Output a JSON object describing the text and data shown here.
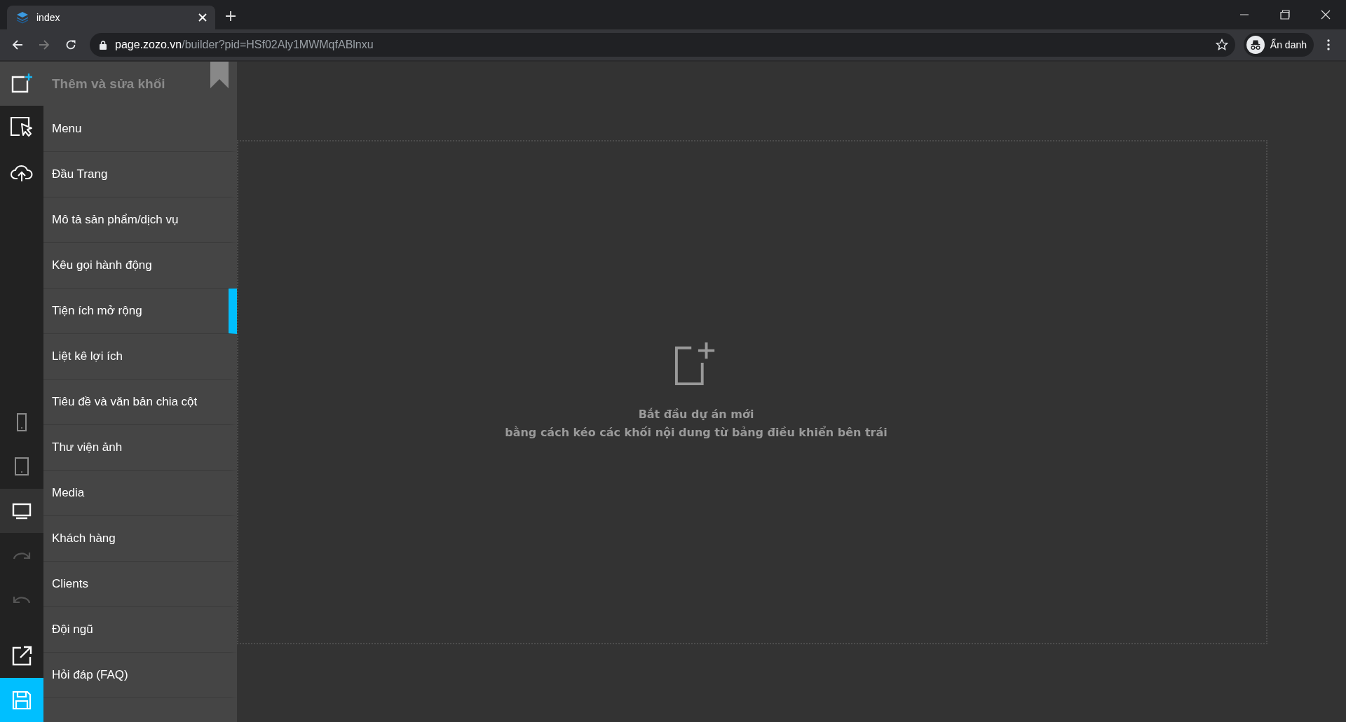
{
  "browser": {
    "tab": {
      "title": "index"
    },
    "url": {
      "host": "page.zozo.vn",
      "path": "/builder?pid=HSf02Aly1MWMqfABlnxu"
    },
    "profile": {
      "label": "Ẩn danh"
    }
  },
  "rail": [
    {
      "kind": "add",
      "selected": true,
      "disabled": false
    },
    {
      "kind": "select",
      "selected": false,
      "disabled": false
    },
    {
      "kind": "cloud",
      "selected": false,
      "disabled": false
    },
    {
      "kind": "mobile",
      "selected": false,
      "disabled": false
    },
    {
      "kind": "tablet",
      "selected": false,
      "disabled": false
    },
    {
      "kind": "desktop",
      "selected": true,
      "disabled": false
    },
    {
      "kind": "redo",
      "selected": false,
      "disabled": true
    },
    {
      "kind": "undo",
      "selected": false,
      "disabled": true
    },
    {
      "kind": "preview",
      "selected": false,
      "disabled": false
    },
    {
      "kind": "save",
      "selected": false,
      "disabled": false
    }
  ],
  "panel": {
    "title": "Thêm và sửa khối",
    "items": [
      {
        "label": "Menu",
        "selected": false
      },
      {
        "label": "Đầu Trang",
        "selected": false
      },
      {
        "label": "Mô tả sản phẩm/dịch vụ",
        "selected": false
      },
      {
        "label": "Kêu gọi hành động",
        "selected": false
      },
      {
        "label": "Tiện ích mở rộng",
        "selected": true
      },
      {
        "label": "Liệt kê lợi ích",
        "selected": false
      },
      {
        "label": "Tiêu đề và văn bản chia cột",
        "selected": false
      },
      {
        "label": "Thư viện ảnh",
        "selected": false
      },
      {
        "label": "Media",
        "selected": false
      },
      {
        "label": "Khách hàng",
        "selected": false
      },
      {
        "label": "Clients",
        "selected": false
      },
      {
        "label": "Đội ngũ",
        "selected": false
      },
      {
        "label": "Hỏi đáp (FAQ)",
        "selected": false
      }
    ]
  },
  "canvas": {
    "empty_title": "Bắt đầu dự án mới",
    "empty_hint": "bằng cách kéo các khối nội dung từ bảng điều khiển bên trái"
  }
}
